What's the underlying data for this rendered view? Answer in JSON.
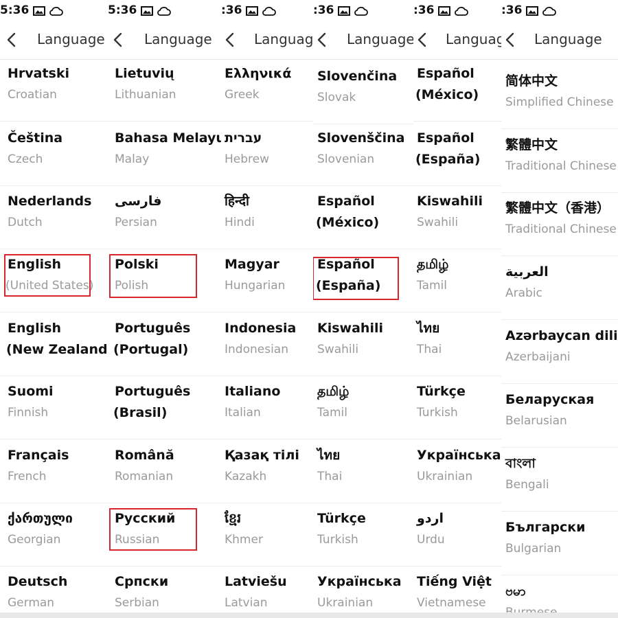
{
  "status_time": ":36",
  "header_title": "Language",
  "panels": [
    {
      "time": "5:36",
      "items": [
        {
          "n": "Hrvatski",
          "e": "Croatian"
        },
        {
          "n": "Čeština",
          "e": "Czech"
        },
        {
          "n": "Nederlands",
          "e": "Dutch"
        },
        {
          "n": "English",
          "e": "(United States)",
          "hl": true
        },
        {
          "n": "English",
          "n2": "(New Zealand)"
        },
        {
          "n": "Suomi",
          "e": "Finnish"
        },
        {
          "n": "Français",
          "e": "French"
        },
        {
          "n": "ქართული",
          "e": "Georgian"
        },
        {
          "n": "Deutsch",
          "e": "German"
        }
      ]
    },
    {
      "time": "5:36",
      "items": [
        {
          "n": "Lietuvių",
          "e": "Lithuanian"
        },
        {
          "n": "Bahasa Melayu",
          "e": "Malay"
        },
        {
          "n": "فارسی",
          "e": "Persian"
        },
        {
          "n": "Polski",
          "e": "Polish",
          "hl": true
        },
        {
          "n": "Português",
          "n2": "(Portugal)"
        },
        {
          "n": "Português",
          "n2": "(Brasil)"
        },
        {
          "n": "Română",
          "e": "Romanian"
        },
        {
          "n": "Русский",
          "e": "Russian",
          "hl": true
        },
        {
          "n": "Српски",
          "e": "Serbian"
        }
      ]
    },
    {
      "time": ":36",
      "items": [
        {
          "n": "Ελληνικά",
          "e": "Greek"
        },
        {
          "n": "עברית",
          "e": "Hebrew"
        },
        {
          "n": "हिन्दी",
          "e": "Hindi"
        },
        {
          "n": "Magyar",
          "e": "Hungarian"
        },
        {
          "n": "Indonesia",
          "e": "Indonesian"
        },
        {
          "n": "Italiano",
          "e": "Italian"
        },
        {
          "n": "Қазақ тілі",
          "e": "Kazakh"
        },
        {
          "n": "ខ្មែរ",
          "e": "Khmer"
        },
        {
          "n": "Latviešu",
          "e": "Latvian"
        }
      ]
    },
    {
      "time": ":36",
      "items": [
        {
          "n": "Slovenčina",
          "e": "Slovak"
        },
        {
          "n": "Slovenščina",
          "e": "Slovenian"
        },
        {
          "n": "Español",
          "n2": "(México)"
        },
        {
          "n": "Español",
          "n2": "(España)",
          "hl": true
        },
        {
          "n": "Kiswahili",
          "e": "Swahili"
        },
        {
          "n": "தமிழ்",
          "e": "Tamil"
        },
        {
          "n": "ไทย",
          "e": "Thai"
        },
        {
          "n": "Türkçe",
          "e": "Turkish"
        },
        {
          "n": "Українська",
          "e": "Ukrainian"
        }
      ]
    },
    {
      "time": ":36",
      "items": [
        {
          "n": "Español",
          "n2": "(México)"
        },
        {
          "n": "Español",
          "n2": "(España)"
        },
        {
          "n": "Kiswahili",
          "e": "Swahili"
        },
        {
          "n": "தமிழ்",
          "e": "Tamil"
        },
        {
          "n": "ไทย",
          "e": "Thai"
        },
        {
          "n": "Türkçe",
          "e": "Turkish"
        },
        {
          "n": "Українська",
          "e": "Ukrainian"
        },
        {
          "n": "اردو",
          "e": "Urdu"
        },
        {
          "n": "Tiếng Việt",
          "e": "Vietnamese"
        }
      ]
    },
    {
      "time": ":36",
      "items": [
        {
          "n": "简体中文",
          "e": "Simplified Chinese"
        },
        {
          "n": "繁體中文",
          "e": "Traditional Chinese"
        },
        {
          "n": "繁體中文（香港）",
          "e": "Traditional Chinese"
        },
        {
          "n": "العربية",
          "e": "Arabic"
        },
        {
          "n": "Azərbaycan dili",
          "e": "Azerbaijani"
        },
        {
          "n": "Беларуская",
          "e": "Belarusian"
        },
        {
          "n": "বাংলা",
          "e": "Bengali"
        },
        {
          "n": "Български",
          "e": "Bulgarian"
        },
        {
          "n": "ဗမာ",
          "e": "Burmese"
        }
      ]
    }
  ]
}
